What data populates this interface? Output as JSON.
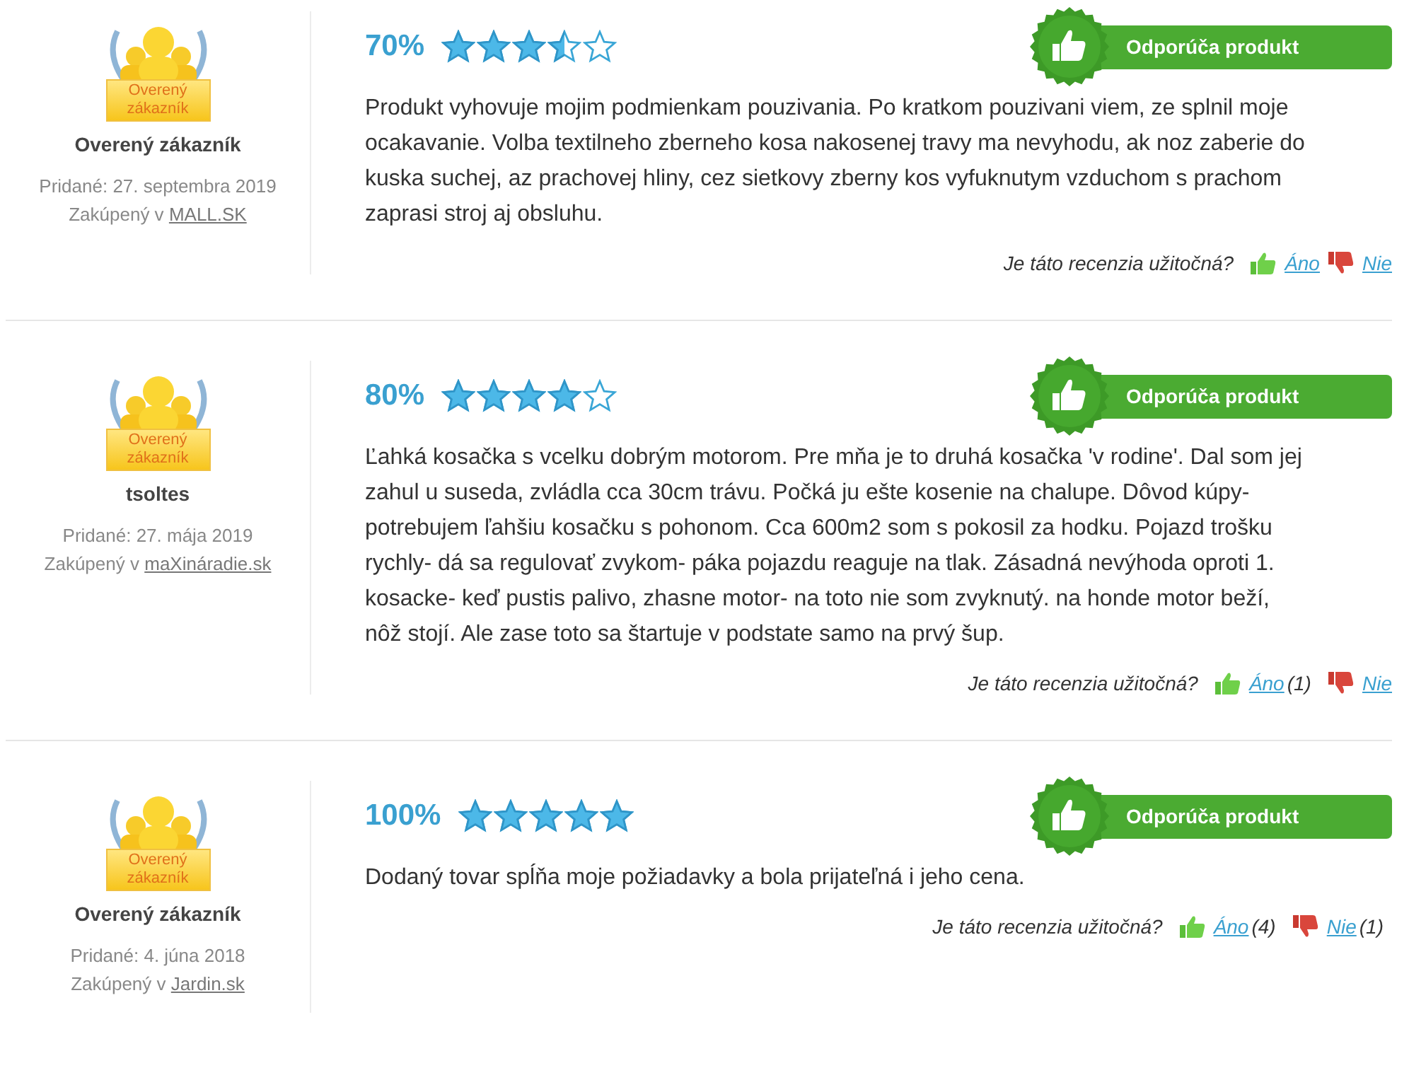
{
  "reviews": [
    {
      "badge_text": "Overený zákazník",
      "name": "Overený zákazník",
      "added": "Pridané: 27. septembra 2019",
      "purchased": "Zakúpený v",
      "shop": "MALL.SK",
      "rating": "70%",
      "stars": 3.5,
      "recommend": "Odporúča produkt",
      "text": "Produkt vyhovuje mojim podmienkam pouzivania. Po kratkom pouzivani viem, ze splnil moje ocakavanie. Volba textilneho zberneho kosa nakosenej travy ma nevyhodu, ak noz zaberie do kuska suchej, az prachovej hliny, cez sietkovy zberny kos vyfuknutym vzduchom s prachom zaprasi stroj aj obsluhu.",
      "helpful": {
        "question": "Je táto recenzia užitočná?",
        "yes": "Áno",
        "no": "Nie"
      }
    },
    {
      "badge_text": "Overený zákazník",
      "name": "tsoltes",
      "added": "Pridané: 27. mája 2019",
      "purchased": "Zakúpený v",
      "shop": "maXináradie.sk",
      "rating": "80%",
      "stars": 4,
      "recommend": "Odporúča produkt",
      "text": "Ľahká kosačka s vcelku dobrým motorom. Pre mňa je to druhá kosačka 'v rodine'. Dal som jej zahul u suseda, zvládla cca 30cm trávu. Počká ju ešte kosenie na chalupe. Dôvod kúpy- potrebujem ľahšiu kosačku s pohonom. Cca 600m2 som s pokosil za hodku. Pojazd trošku rychly- dá sa regulovať zvykom- páka pojazdu reaguje na tlak. Zásadná nevýhoda oproti 1. kosacke- keď pustis palivo, zhasne motor- na toto nie som zvyknutý. na honde motor beží, nôž stojí. Ale zase toto sa štartuje v podstate samo na prvý šup.",
      "helpful": {
        "question": "Je táto recenzia užitočná?",
        "yes": "Áno",
        "yes_count": "(1)",
        "no": "Nie"
      }
    },
    {
      "badge_text": "Overený zákazník",
      "name": "Overený zákazník",
      "added": "Pridané: 4. júna 2018",
      "purchased": "Zakúpený v",
      "shop": "Jardin.sk",
      "rating": "100%",
      "stars": 5,
      "recommend": "Odporúča produkt",
      "text": "Dodaný tovar spĺňa moje požiadavky a bola prijateľná i jeho cena.",
      "helpful": {
        "question": "Je táto recenzia užitočná?",
        "yes": "Áno",
        "yes_count": "(4)",
        "no": "Nie",
        "no_count": "(1)"
      }
    }
  ]
}
